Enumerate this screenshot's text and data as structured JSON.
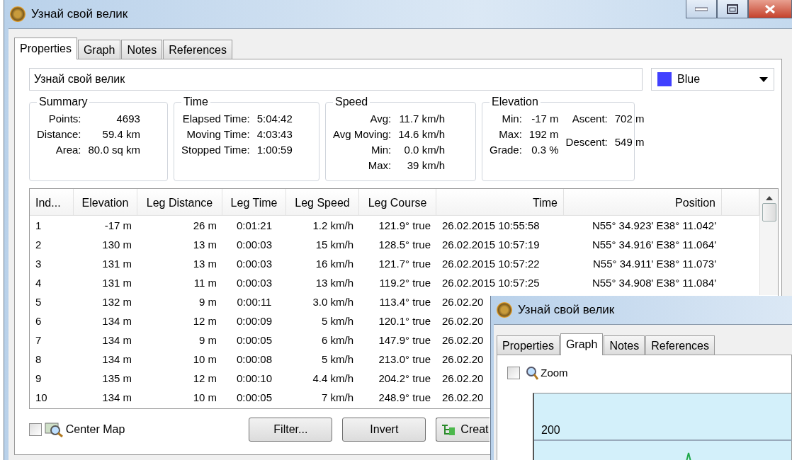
{
  "window": {
    "title": "Узнай свой велик"
  },
  "tabs": [
    {
      "label": "Properties",
      "selected": true
    },
    {
      "label": "Graph",
      "selected": false
    },
    {
      "label": "Notes",
      "selected": false
    },
    {
      "label": "References",
      "selected": false
    }
  ],
  "name_field": {
    "value": "Узнай свой велик"
  },
  "color_select": {
    "value": "Blue"
  },
  "groups": [
    {
      "title": "Summary",
      "columns": [
        [
          {
            "label": "Points:",
            "value": "4693"
          },
          {
            "label": "Distance:",
            "value": "59.4 km"
          },
          {
            "label": "Area:",
            "value": "80.0 sq km"
          }
        ]
      ]
    },
    {
      "title": "Time",
      "columns": [
        [
          {
            "label": "Elapsed Time:",
            "value": "5:04:42"
          },
          {
            "label": "Moving Time:",
            "value": "4:03:43"
          },
          {
            "label": "Stopped Time:",
            "value": "1:00:59"
          }
        ]
      ]
    },
    {
      "title": "Speed",
      "columns": [
        [
          {
            "label": "Avg:",
            "value": "11.7 km/h"
          },
          {
            "label": "Avg Moving:",
            "value": "14.6 km/h"
          },
          {
            "label": "Min:",
            "value": "0.0 km/h"
          },
          {
            "label": "Max:",
            "value": "39 km/h"
          }
        ]
      ]
    },
    {
      "title": "Elevation",
      "columns": [
        [
          {
            "label": "Min:",
            "value": "-17 m"
          },
          {
            "label": "Max:",
            "value": "192 m"
          },
          {
            "label": "Grade:",
            "value": "0.3 %"
          }
        ],
        [
          {
            "label": "Ascent:",
            "value": "702 m"
          },
          {
            "label": "Descent:",
            "value": "549 m"
          }
        ]
      ]
    }
  ],
  "table": {
    "columns": [
      "Ind...",
      "Elevation",
      "Leg Distance",
      "Leg Time",
      "Leg Speed",
      "Leg Course",
      "Time",
      "Position"
    ],
    "rows": [
      [
        "1",
        "-17 m",
        "26 m",
        "0:01:21",
        "1.2 km/h",
        "121.9° true",
        "26.02.2015 10:55:58",
        "N55° 34.923' E38° 11.042'"
      ],
      [
        "2",
        "130 m",
        "13 m",
        "0:00:03",
        "15 km/h",
        "128.5° true",
        "26.02.2015 10:57:19",
        "N55° 34.916' E38° 11.064'"
      ],
      [
        "3",
        "131 m",
        "13 m",
        "0:00:03",
        "16 km/h",
        "121.7° true",
        "26.02.2015 10:57:22",
        "N55° 34.911' E38° 11.073'"
      ],
      [
        "4",
        "131 m",
        "11 m",
        "0:00:03",
        "13 km/h",
        "119.2° true",
        "26.02.2015 10:57:25",
        "N55° 34.908' E38° 11.084'"
      ],
      [
        "5",
        "132 m",
        "9 m",
        "0:00:11",
        "3.0 km/h",
        "113.4° true",
        "26.02.20",
        null
      ],
      [
        "6",
        "134 m",
        "12 m",
        "0:00:09",
        "5 km/h",
        "120.1° true",
        "26.02.20",
        null
      ],
      [
        "7",
        "134 m",
        "9 m",
        "0:00:05",
        "6 km/h",
        "147.9° true",
        "26.02.20",
        null
      ],
      [
        "8",
        "134 m",
        "10 m",
        "0:00:08",
        "5 km/h",
        "213.0° true",
        "26.02.20",
        null
      ],
      [
        "9",
        "135 m",
        "12 m",
        "0:00:10",
        "4.4 km/h",
        "204.2° true",
        "26.02.20",
        null
      ],
      [
        "10",
        "134 m",
        "10 m",
        "0:00:05",
        "7 km/h",
        "248.9° true",
        "26.02.20",
        null
      ]
    ]
  },
  "center_map": {
    "label": "Center Map",
    "checked": false
  },
  "buttons": [
    {
      "label": "Filter...",
      "kind": "plain"
    },
    {
      "label": "Invert",
      "kind": "plain"
    },
    {
      "label": "Creat",
      "kind": "create"
    }
  ],
  "graph_window": {
    "title": "Узнай свой велик",
    "tabs": [
      {
        "label": "Properties",
        "selected": false
      },
      {
        "label": "Graph",
        "selected": true
      },
      {
        "label": "Notes",
        "selected": false
      },
      {
        "label": "References",
        "selected": false
      }
    ],
    "zoom": {
      "label": "Zoom",
      "checked": false
    },
    "graph": {
      "tick_label": "200"
    }
  }
}
